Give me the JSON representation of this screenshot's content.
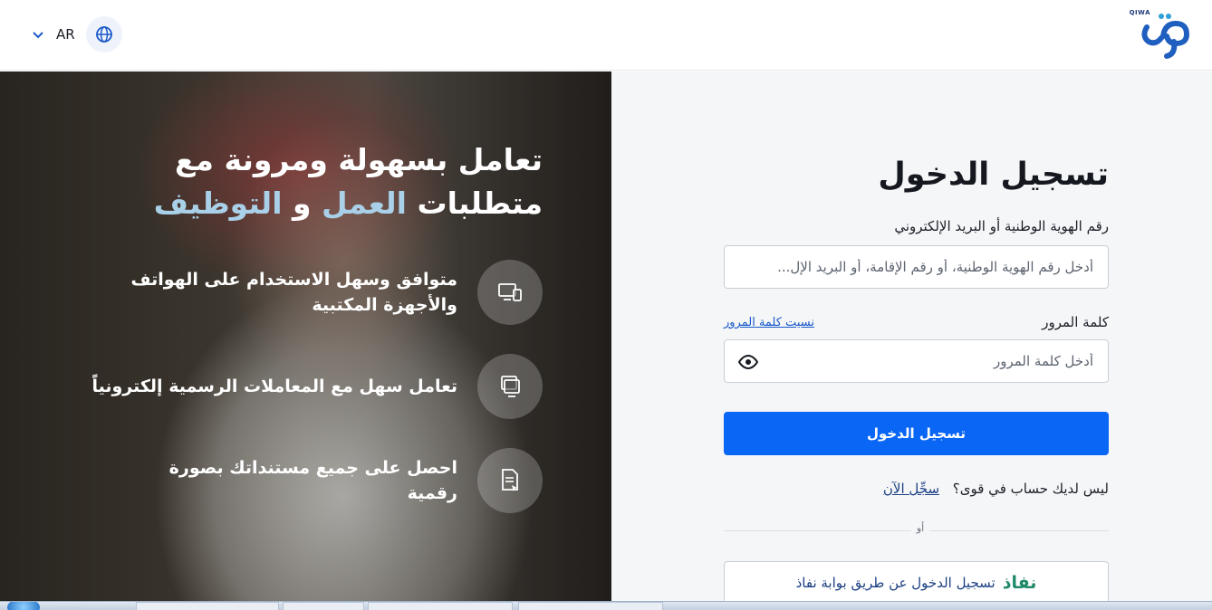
{
  "header": {
    "logo_text": "QIWA",
    "language_code": "AR"
  },
  "hero": {
    "title_line1": "تعامل بسهولة ومرونة مع",
    "title_part1": "متطلبات",
    "title_accent1": "العمل",
    "title_joiner": "و",
    "title_accent2": "التوظيف",
    "features": [
      {
        "text": "متوافق وسهل الاستخدام على الهواتف والأجهزة المكتبية",
        "icon": "devices-icon"
      },
      {
        "text": "تعامل سهل مع المعاملات الرسمية إلكترونياً",
        "icon": "computer-icon"
      },
      {
        "text": "احصل على جميع مستنداتك بصورة رقمية",
        "icon": "document-icon"
      }
    ]
  },
  "form": {
    "title": "تسجيل الدخول",
    "id_label": "رقم الهوية الوطنية أو البريد الإلكتروني",
    "id_placeholder": "أدخل رقم الهوية الوطنية، أو رقم الإقامة، أو البريد الإل...",
    "password_label": "كلمة المرور",
    "forgot_password": "نسيت كلمة المرور",
    "password_placeholder": "أدخل كلمة المرور",
    "login_button": "تسجيل الدخول",
    "no_account_text": "ليس لديك حساب في قوى؟",
    "signup_link": "سجِّل الآن",
    "or_text": "أو",
    "nafath_logo": "نفاذ",
    "nafath_button": "تسجيل الدخول عن طريق بوابة نفاذ"
  },
  "colors": {
    "primary": "#0a66f5",
    "accent_text": "#a9d0e8",
    "link": "#1758c9",
    "nafath_green": "#1f8a6a"
  }
}
